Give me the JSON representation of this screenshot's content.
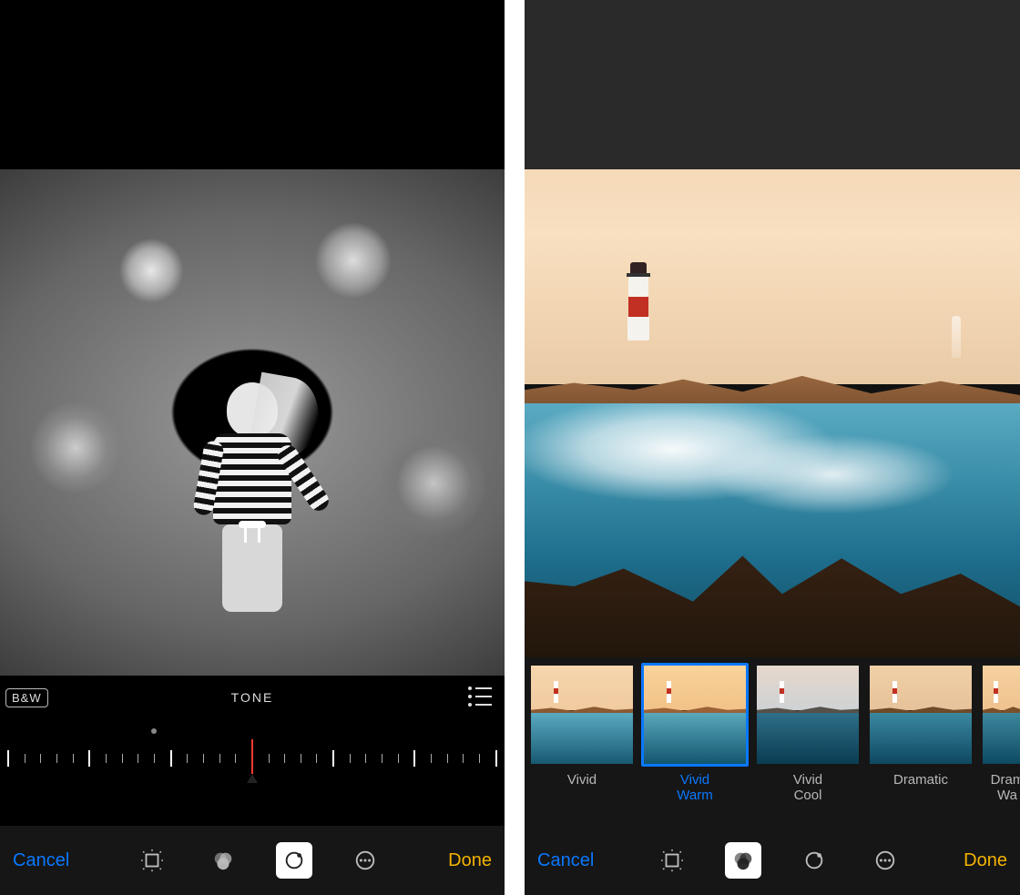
{
  "left": {
    "bw_badge": "B&W",
    "slider_title": "TONE",
    "list_icon_name": "list-icon",
    "toolbar": {
      "cancel": "Cancel",
      "done": "Done",
      "tools": {
        "crop": "crop-rotate-icon",
        "filters": "filters-icon",
        "adjust": "adjust-icon",
        "more": "more-icon",
        "active": "adjust"
      }
    }
  },
  "right": {
    "filters": [
      {
        "id": "vivid",
        "label": "Vivid",
        "selected": false
      },
      {
        "id": "vividwarm",
        "label": "Vivid\nWarm",
        "selected": true
      },
      {
        "id": "vividcool",
        "label": "Vivid\nCool",
        "selected": false
      },
      {
        "id": "dramatic",
        "label": "Dramatic",
        "selected": false
      },
      {
        "id": "dramwarm",
        "label": "Dram\nWa",
        "selected": false,
        "partial": true
      }
    ],
    "toolbar": {
      "cancel": "Cancel",
      "done": "Done",
      "tools": {
        "crop": "crop-rotate-icon",
        "filters": "filters-icon",
        "adjust": "adjust-icon",
        "more": "more-icon",
        "active": "filters"
      }
    }
  },
  "colors": {
    "accent_blue": "#0a78ff",
    "accent_yellow": "#f5b301",
    "needle_red": "#ff3b30"
  }
}
